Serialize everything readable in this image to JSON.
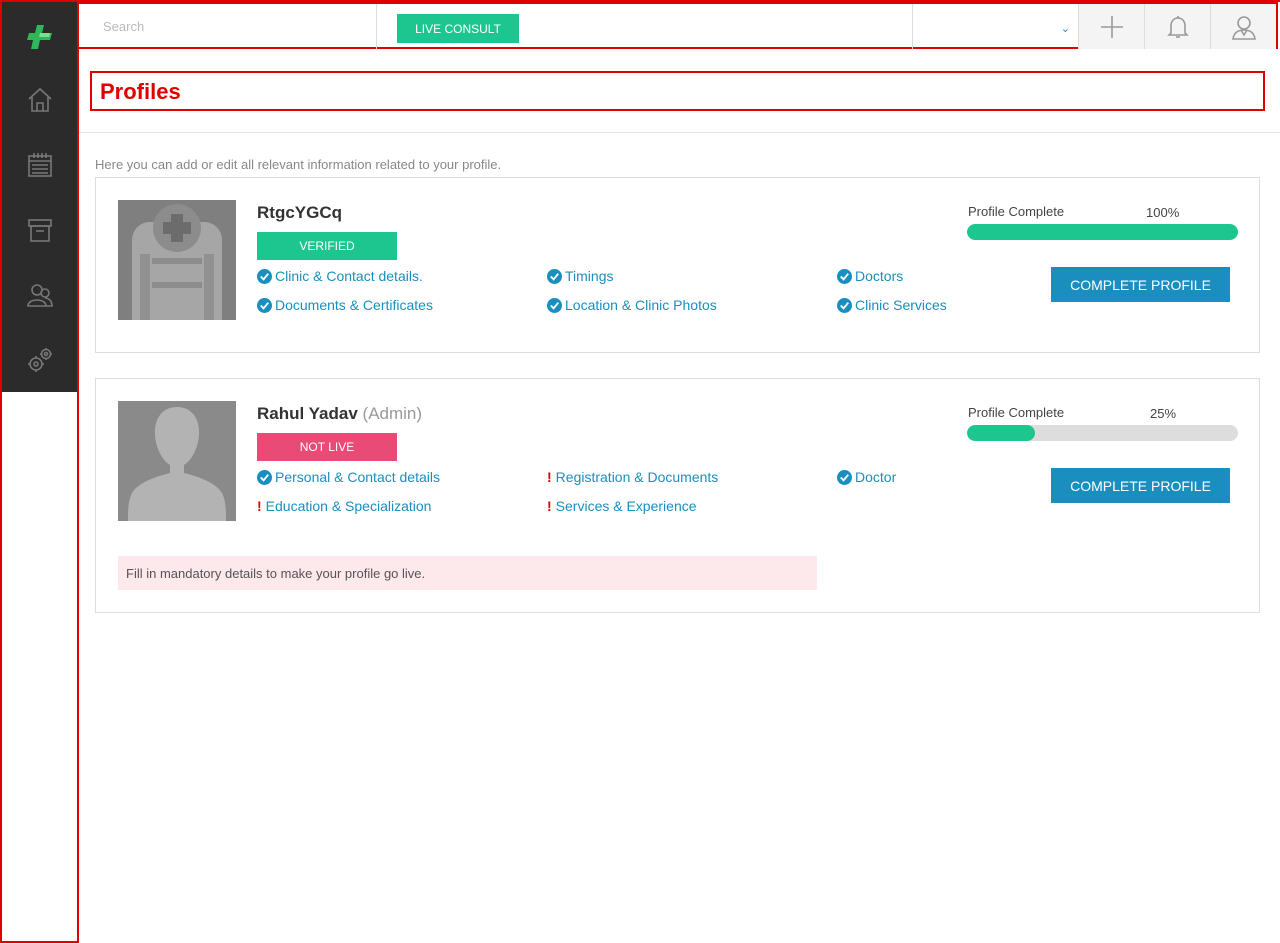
{
  "colors": {
    "accent_green": "#1ec68f",
    "accent_blue": "#1a8fbf",
    "alert_pink": "#e94a76",
    "highlight_red": "#e00000",
    "sidebar_bg": "#2b2b2b"
  },
  "topbar": {
    "search_placeholder": "Search",
    "live_consult_label": "LIVE CONSULT",
    "dropdown_value": "",
    "icons": [
      "plus-icon",
      "bell-icon",
      "user-icon"
    ]
  },
  "sidebar": {
    "items": [
      {
        "icon": "home-icon"
      },
      {
        "icon": "calendar-icon"
      },
      {
        "icon": "archive-icon"
      },
      {
        "icon": "patients-icon"
      },
      {
        "icon": "settings-icon"
      }
    ]
  },
  "page": {
    "title": "Profiles",
    "intro": "Here you can add or edit all relevant information related to your profile."
  },
  "profiles": [
    {
      "name": "RtgcYGCq",
      "role": "",
      "status": "VERIFIED",
      "progress_label": "Profile Complete",
      "progress_text": "100%",
      "progress_value": 1.0,
      "cta": "COMPLETE PROFILE",
      "items": [
        {
          "label": "Clinic & Contact details.",
          "state": "done"
        },
        {
          "label": "Timings",
          "state": "done"
        },
        {
          "label": "Doctors",
          "state": "done"
        },
        {
          "label": "Documents & Certificates",
          "state": "done"
        },
        {
          "label": "Location & Clinic Photos",
          "state": "done"
        },
        {
          "label": "Clinic Services",
          "state": "done"
        }
      ]
    },
    {
      "name": "Rahul Yadav",
      "role": "(Admin)",
      "status": "NOT LIVE",
      "progress_label": "Profile Complete",
      "progress_text": "25%",
      "progress_value": 0.25,
      "cta": "COMPLETE PROFILE",
      "warn_mark": "!",
      "items": [
        {
          "label": "Personal & Contact details",
          "state": "done"
        },
        {
          "label": "Registration & Documents",
          "state": "missing"
        },
        {
          "label": "Doctor",
          "state": "done"
        },
        {
          "label": "Education & Specialization",
          "state": "missing"
        },
        {
          "label": "Services & Experience",
          "state": "missing"
        }
      ],
      "alert": "Fill in mandatory details to make your profile go live."
    }
  ]
}
